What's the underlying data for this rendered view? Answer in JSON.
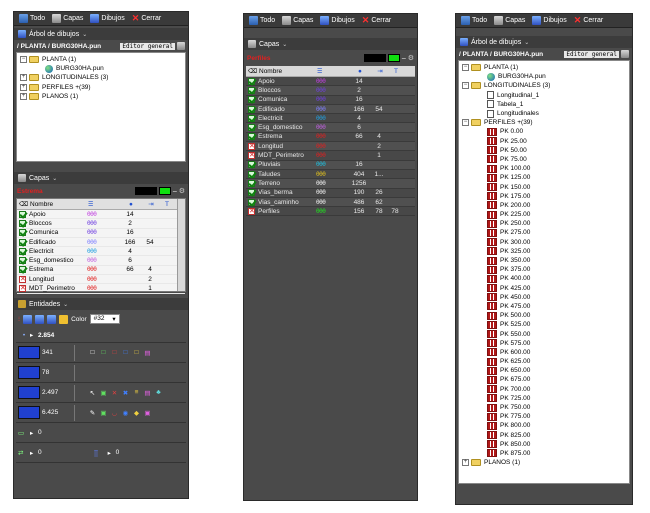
{
  "toolbar": {
    "todo": "Todo",
    "capas": "Capas",
    "dibujos": "Dibujos",
    "cerrar": "Cerrar"
  },
  "panel1": {
    "tree_title": "Árbol de dibujos",
    "path": "/ PLANTA / BURG30HA.pun",
    "editor": "Editor general",
    "tree": [
      {
        "label": "PLANTA (1)",
        "icon": "folder",
        "pm": "−",
        "indent": 0
      },
      {
        "label": "BURG30HA.pun",
        "icon": "globe",
        "pm": "",
        "indent": 2
      },
      {
        "label": "LONGITUDINALES (3)",
        "icon": "folder",
        "pm": "+",
        "indent": 0
      },
      {
        "label": "PERFILES +(39)",
        "icon": "folder",
        "pm": "+",
        "indent": 0
      },
      {
        "label": "PLANOS (1)",
        "icon": "folder",
        "pm": "+",
        "indent": 0
      }
    ],
    "capas_title": "Capas",
    "active_layer": "Estrema",
    "col_nombre": "Nombre",
    "col_t": "T",
    "layers": [
      {
        "name": "Apoio",
        "style": "000",
        "n1": "14",
        "n2": "",
        "n3": "",
        "state": "on",
        "color": "#c040e0"
      },
      {
        "name": "Bloccos",
        "style": "000",
        "n1": "2",
        "n2": "",
        "n3": "",
        "state": "on",
        "color": "#7040e0"
      },
      {
        "name": "Comunica",
        "style": "000",
        "n1": "16",
        "n2": "",
        "n3": "",
        "state": "on",
        "color": "#7040e0"
      },
      {
        "name": "Edificado",
        "style": "000",
        "n1": "166",
        "n2": "54",
        "n3": "",
        "state": "on",
        "color": "#8080ff"
      },
      {
        "name": "Electricit",
        "style": "000",
        "n1": "4",
        "n2": "",
        "n3": "",
        "state": "on",
        "color": "#20a0e0"
      },
      {
        "name": "Esg_domestico",
        "style": "000",
        "n1": "6",
        "n2": "",
        "n3": "",
        "state": "on",
        "color": "#c060e0"
      },
      {
        "name": "Estrema",
        "style": "000",
        "n1": "66",
        "n2": "4",
        "n3": "",
        "state": "on",
        "color": "#e02020"
      },
      {
        "name": "Longitud",
        "style": "000",
        "n1": "",
        "n2": "2",
        "n3": "",
        "state": "x",
        "color": "#e02020"
      },
      {
        "name": "MDT_Perimetro",
        "style": "000",
        "n1": "",
        "n2": "1",
        "n3": "",
        "state": "x",
        "color": "#e02020"
      }
    ],
    "entidades_title": "Entidades",
    "color_label": "Color",
    "color_value": "#32",
    "ent_rows": [
      {
        "value": "2.854"
      },
      {
        "value": "341"
      },
      {
        "value": "78"
      },
      {
        "value": "2.497"
      },
      {
        "value": "6.425"
      },
      {
        "value": "0"
      },
      {
        "value": "0"
      }
    ],
    "ent_extra": "0"
  },
  "panel2": {
    "capas_title": "Capas",
    "active_layer": "Perfiles",
    "col_nombre": "Nombre",
    "col_t": "T",
    "layers": [
      {
        "name": "Apoio",
        "style": "000",
        "n1": "14",
        "n2": "",
        "n3": "",
        "state": "on",
        "color": "#c040e0"
      },
      {
        "name": "Bloccos",
        "style": "000",
        "n1": "2",
        "n2": "",
        "n3": "",
        "state": "on",
        "color": "#7040e0"
      },
      {
        "name": "Comunica",
        "style": "000",
        "n1": "16",
        "n2": "",
        "n3": "",
        "state": "on",
        "color": "#7040e0"
      },
      {
        "name": "Edificado",
        "style": "000",
        "n1": "166",
        "n2": "54",
        "n3": "",
        "state": "on",
        "color": "#8080ff"
      },
      {
        "name": "Electricit",
        "style": "000",
        "n1": "4",
        "n2": "",
        "n3": "",
        "state": "on",
        "color": "#20a0e0"
      },
      {
        "name": "Esg_domestico",
        "style": "000",
        "n1": "6",
        "n2": "",
        "n3": "",
        "state": "on",
        "color": "#c060e0"
      },
      {
        "name": "Estrema",
        "style": "000",
        "n1": "66",
        "n2": "4",
        "n3": "",
        "state": "on",
        "color": "#e02020"
      },
      {
        "name": "Longitud",
        "style": "000",
        "n1": "",
        "n2": "2",
        "n3": "",
        "state": "x",
        "color": "#e02020"
      },
      {
        "name": "MDT_Perimetro",
        "style": "000",
        "n1": "",
        "n2": "1",
        "n3": "",
        "state": "x",
        "color": "#e02020"
      },
      {
        "name": "Pluviais",
        "style": "000",
        "n1": "16",
        "n2": "",
        "n3": "",
        "state": "on",
        "color": "#20c0e0"
      },
      {
        "name": "Taludes",
        "style": "000",
        "n1": "404",
        "n2": "1...",
        "n3": "",
        "state": "on",
        "color": "#e0c020"
      },
      {
        "name": "Terreno",
        "style": "000",
        "n1": "1256",
        "n2": "",
        "n3": "",
        "state": "on",
        "color": "#f0f0f0"
      },
      {
        "name": "Vias_berma",
        "style": "000",
        "n1": "190",
        "n2": "26",
        "n3": "",
        "state": "on",
        "color": "#f0f0f0"
      },
      {
        "name": "Vias_caminho",
        "style": "000",
        "n1": "486",
        "n2": "62",
        "n3": "",
        "state": "on",
        "color": "#f0f0f0"
      },
      {
        "name": "Perfiles",
        "style": "000",
        "n1": "156",
        "n2": "78",
        "n3": "78",
        "state": "x",
        "color": "#20e020"
      }
    ]
  },
  "panel3": {
    "tree_title": "Árbol de dibujos",
    "path": "/ PLANTA / BURG30HA.pun",
    "editor": "Editor general",
    "tree": [
      {
        "label": "PLANTA (1)",
        "icon": "folder",
        "pm": "−",
        "indent": 0
      },
      {
        "label": "BURG30HA.pun",
        "icon": "globe",
        "pm": "",
        "indent": 2
      },
      {
        "label": "LONGITUDINALES (3)",
        "icon": "folder",
        "pm": "−",
        "indent": 0
      },
      {
        "label": "Longitudinal_1",
        "icon": "doc",
        "pm": "",
        "indent": 2
      },
      {
        "label": "Tabela_1",
        "icon": "doc",
        "pm": "",
        "indent": 2
      },
      {
        "label": "Longitudinales",
        "icon": "doc",
        "pm": "",
        "indent": 2
      },
      {
        "label": "PERFILES +(39)",
        "icon": "folder",
        "pm": "−",
        "indent": 0
      },
      {
        "label": "PK 0.00",
        "icon": "perf",
        "pm": "",
        "indent": 2
      },
      {
        "label": "PK 25.00",
        "icon": "perf",
        "pm": "",
        "indent": 2
      },
      {
        "label": "PK 50.00",
        "icon": "perf",
        "pm": "",
        "indent": 2
      },
      {
        "label": "PK 75.00",
        "icon": "perf",
        "pm": "",
        "indent": 2
      },
      {
        "label": "PK 100.00",
        "icon": "perf",
        "pm": "",
        "indent": 2
      },
      {
        "label": "PK 125.00",
        "icon": "perf",
        "pm": "",
        "indent": 2
      },
      {
        "label": "PK 150.00",
        "icon": "perf",
        "pm": "",
        "indent": 2
      },
      {
        "label": "PK 175.00",
        "icon": "perf",
        "pm": "",
        "indent": 2
      },
      {
        "label": "PK 200.00",
        "icon": "perf",
        "pm": "",
        "indent": 2
      },
      {
        "label": "PK 225.00",
        "icon": "perf",
        "pm": "",
        "indent": 2
      },
      {
        "label": "PK 250.00",
        "icon": "perf",
        "pm": "",
        "indent": 2
      },
      {
        "label": "PK 275.00",
        "icon": "perf",
        "pm": "",
        "indent": 2
      },
      {
        "label": "PK 300.00",
        "icon": "perf",
        "pm": "",
        "indent": 2
      },
      {
        "label": "PK 325.00",
        "icon": "perf",
        "pm": "",
        "indent": 2
      },
      {
        "label": "PK 350.00",
        "icon": "perf",
        "pm": "",
        "indent": 2
      },
      {
        "label": "PK 375.00",
        "icon": "perf",
        "pm": "",
        "indent": 2
      },
      {
        "label": "PK 400.00",
        "icon": "perf",
        "pm": "",
        "indent": 2
      },
      {
        "label": "PK 425.00",
        "icon": "perf",
        "pm": "",
        "indent": 2
      },
      {
        "label": "PK 450.00",
        "icon": "perf",
        "pm": "",
        "indent": 2
      },
      {
        "label": "PK 475.00",
        "icon": "perf",
        "pm": "",
        "indent": 2
      },
      {
        "label": "PK 500.00",
        "icon": "perf",
        "pm": "",
        "indent": 2
      },
      {
        "label": "PK 525.00",
        "icon": "perf",
        "pm": "",
        "indent": 2
      },
      {
        "label": "PK 550.00",
        "icon": "perf",
        "pm": "",
        "indent": 2
      },
      {
        "label": "PK 575.00",
        "icon": "perf",
        "pm": "",
        "indent": 2
      },
      {
        "label": "PK 600.00",
        "icon": "perf",
        "pm": "",
        "indent": 2
      },
      {
        "label": "PK 625.00",
        "icon": "perf",
        "pm": "",
        "indent": 2
      },
      {
        "label": "PK 650.00",
        "icon": "perf",
        "pm": "",
        "indent": 2
      },
      {
        "label": "PK 675.00",
        "icon": "perf",
        "pm": "",
        "indent": 2
      },
      {
        "label": "PK 700.00",
        "icon": "perf",
        "pm": "",
        "indent": 2
      },
      {
        "label": "PK 725.00",
        "icon": "perf",
        "pm": "",
        "indent": 2
      },
      {
        "label": "PK 750.00",
        "icon": "perf",
        "pm": "",
        "indent": 2
      },
      {
        "label": "PK 775.00",
        "icon": "perf",
        "pm": "",
        "indent": 2
      },
      {
        "label": "PK 800.00",
        "icon": "perf",
        "pm": "",
        "indent": 2
      },
      {
        "label": "PK 825.00",
        "icon": "perf",
        "pm": "",
        "indent": 2
      },
      {
        "label": "PK 850.00",
        "icon": "perf",
        "pm": "",
        "indent": 2
      },
      {
        "label": "PK 875.00",
        "icon": "perf",
        "pm": "",
        "indent": 2
      },
      {
        "label": "PLANOS (1)",
        "icon": "folder",
        "pm": "+",
        "indent": 0
      }
    ]
  }
}
